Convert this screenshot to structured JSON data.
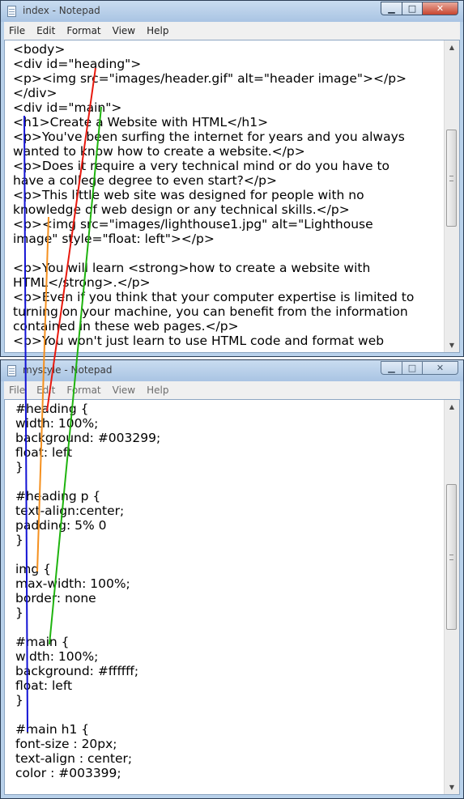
{
  "window_index": {
    "title": "index - Notepad",
    "controls": {
      "minimize_glyph": "▁",
      "maximize_glyph": "□",
      "close_glyph": "✕"
    },
    "menu": [
      "File",
      "Edit",
      "Format",
      "View",
      "Help"
    ],
    "lines": [
      "<body>",
      "<div id=\"heading\">",
      "<p><img src=\"images/header.gif\" alt=\"header image\"></p>",
      "</div>",
      "<div id=\"main\">",
      "<h1>Create a Website with HTML</h1>",
      "<p>You've been surfing the internet for years and you always",
      "wanted to know how to create a website.</p>",
      "<p>Does it require a very technical mind or do you have to",
      "have a college degree to even start?</p>",
      "<p>This little web site was designed for people with no",
      "knowledge of web design or any technical skills.</p>",
      "<p><img src=\"images/lighthouse1.jpg\" alt=\"Lighthouse",
      "image\" style=\"float: left\"></p>",
      "",
      "<p>You will learn <strong>how to create a website with",
      "HTML</strong>.</p>",
      "<p>Even if you think that your computer expertise is limited to",
      "turning on your machine, you can benefit from the information",
      "contained in these web pages.</p>",
      "<p>You won't just learn to use HTML code and format web"
    ]
  },
  "window_mystyle": {
    "title": "mystyle - Notepad",
    "controls": {
      "minimize_glyph": "▁",
      "maximize_glyph": "□",
      "close_glyph": "✕"
    },
    "menu": [
      "File",
      "Edit",
      "Format",
      "View",
      "Help"
    ],
    "lines": [
      "#heading {",
      "width: 100%;",
      "background: #003299;",
      "float: left",
      "}",
      "",
      "#heading p {",
      "text-align:center;",
      "padding: 5% 0",
      "}",
      "",
      "img {",
      "max-width: 100%;",
      "border: none",
      "}",
      "",
      "#main {",
      "width: 100%;",
      "background: #ffffff;",
      "float: left",
      "}",
      "",
      "#main h1 {",
      "font-size : 20px;",
      "text-align : center;",
      "color : #003399;"
    ]
  },
  "scrollbar": {
    "up_glyph": "▲",
    "down_glyph": "▼"
  },
  "annotation_colors": {
    "heading": "#e8190e",
    "img": "#f5901e",
    "main": "#1fb40f",
    "main_h1": "#1212d4"
  }
}
